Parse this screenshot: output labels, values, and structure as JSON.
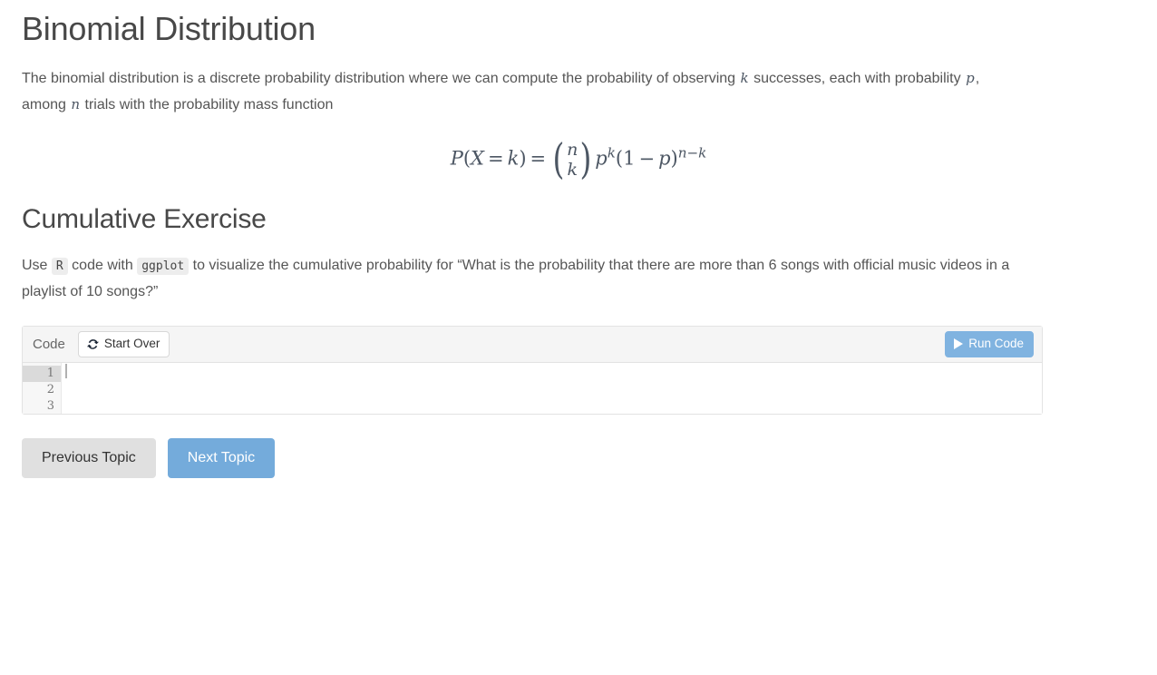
{
  "page": {
    "title": "Binomial Distribution",
    "intro_part1": "The binomial distribution is a discrete probability distribution where we can compute the probability of observing ",
    "intro_var_k": "k",
    "intro_part2": " successes, each with probability ",
    "intro_var_p": "p",
    "intro_part3": ", among ",
    "intro_var_n": "n",
    "intro_part4": " trials with the probability mass function"
  },
  "formula": {
    "lhs_p": "P",
    "lhs_open": "(",
    "lhs_x": "X",
    "lhs_eq_inner": "=",
    "lhs_k": "k",
    "lhs_close": ")",
    "equals": "=",
    "binom_top": "n",
    "binom_bottom": "k",
    "paren_open": "(",
    "paren_close": ")",
    "p_base": "p",
    "p_exp": "k",
    "group_open": "(",
    "one": "1",
    "minus": "−",
    "p_inner": "p",
    "group_close": ")",
    "group_exp": "n−k",
    "plain": "P(X = k) = (n choose k) p^k (1 − p)^(n−k)"
  },
  "exercise": {
    "heading": "Cumulative Exercise",
    "text_part1": "Use ",
    "code_r": "R",
    "text_part2": " code with ",
    "code_ggplot": "ggplot",
    "text_part3": " to visualize the cumulative probability for “What is the probability that there are more than 6 songs with official music videos in a playlist of 10 songs?”"
  },
  "editor": {
    "label": "Code",
    "start_over_label": "Start Over",
    "start_over_icon": "refresh-icon",
    "run_label": "Run Code",
    "run_icon": "play-icon",
    "line_numbers": [
      "1",
      "2",
      "3"
    ],
    "lines": [
      "",
      "",
      ""
    ],
    "active_line": 1
  },
  "navigation": {
    "previous_label": "Previous Topic",
    "next_label": "Next Topic"
  },
  "colors": {
    "accent_blue": "#80b3e0",
    "next_button_blue": "#74abdb",
    "prev_button_gray": "#e0e0e0",
    "heading_gray": "#484848",
    "body_gray": "#555555",
    "code_bg": "#ededed",
    "editor_header_bg": "#f5f5f5",
    "gutter_bg": "#f7f7f7",
    "active_line_bg": "#dadada"
  }
}
